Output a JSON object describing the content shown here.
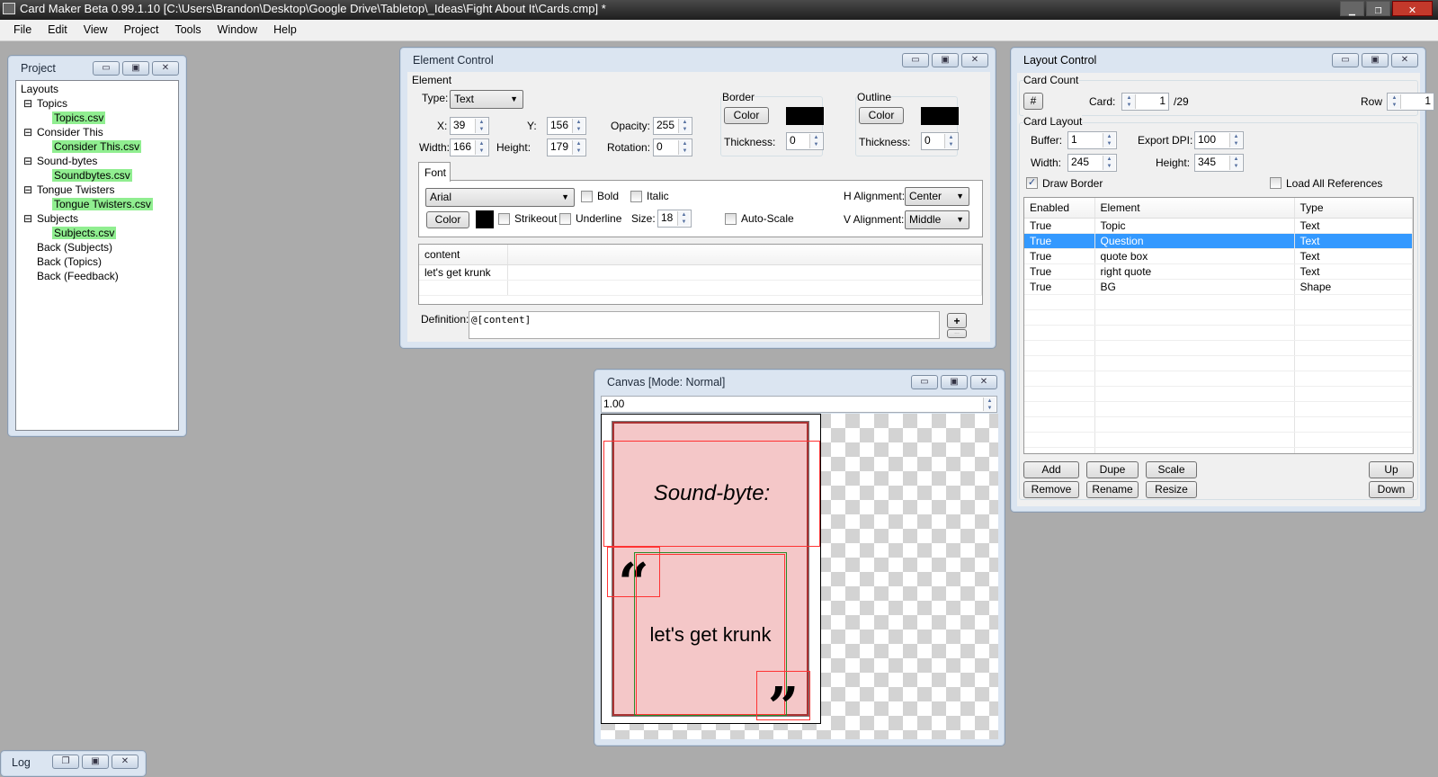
{
  "app": {
    "title": "Card Maker Beta 0.99.1.10 [C:\\Users\\Brandon\\Desktop\\Google Drive\\Tabletop\\_Ideas\\Fight About It\\Cards.cmp] *"
  },
  "menu": [
    "File",
    "Edit",
    "View",
    "Project",
    "Tools",
    "Window",
    "Help"
  ],
  "project": {
    "title": "Project",
    "root": "Layouts",
    "items": [
      {
        "label": "Topics",
        "file": "Topics.csv"
      },
      {
        "label": "Consider This",
        "file": "Consider This.csv"
      },
      {
        "label": "Sound-bytes",
        "file": "Soundbytes.csv"
      },
      {
        "label": "Tongue Twisters",
        "file": "Tongue Twisters.csv"
      },
      {
        "label": "Subjects",
        "file": "Subjects.csv"
      }
    ],
    "leaves": [
      "Back (Subjects)",
      "Back (Topics)",
      "Back (Feedback)"
    ]
  },
  "log": {
    "title": "Log"
  },
  "element": {
    "title": "Element Control",
    "group": "Element",
    "type_label": "Type:",
    "type": "Text",
    "x_label": "X:",
    "x": "39",
    "y_label": "Y:",
    "y": "156",
    "opacity_label": "Opacity:",
    "opacity": "255",
    "width_label": "Width:",
    "width": "166",
    "height_label": "Height:",
    "height": "179",
    "rotation_label": "Rotation:",
    "rotation": "0",
    "border": {
      "label": "Border",
      "color_btn": "Color",
      "thickness_label": "Thickness:",
      "thickness": "0",
      "color": "#000000"
    },
    "outline": {
      "label": "Outline",
      "color_btn": "Color",
      "thickness_label": "Thickness:",
      "thickness": "0",
      "color": "#000000"
    },
    "font_tab": "Font",
    "font": "Arial",
    "bold": "Bold",
    "italic": "Italic",
    "color_btn": "Color",
    "strikeout": "Strikeout",
    "underline": "Underline",
    "size_label": "Size:",
    "size": "18",
    "autoscale": "Auto-Scale",
    "halign_label": "H Alignment:",
    "halign": "Center",
    "valign_label": "V Alignment:",
    "valign": "Middle",
    "grid_header": "content",
    "grid_value": "let's get krunk",
    "definition_label": "Definition:",
    "definition": "@[content]",
    "plus": "+",
    "more": "..."
  },
  "canvas": {
    "title": "Canvas [Mode: Normal]",
    "zoom": "1.00",
    "topic_text": "Sound-byte:",
    "question_text": "let's get krunk",
    "open_quote": "“",
    "close_quote": "”"
  },
  "layout": {
    "title": "Layout Control",
    "card_count": "Card Count",
    "hash": "#",
    "card_label": "Card:",
    "card": "1",
    "total": "/29",
    "row_label": "Row",
    "row": "1",
    "card_layout": "Card Layout",
    "buffer_label": "Buffer:",
    "buffer": "1",
    "dpi_label": "Export DPI:",
    "dpi": "100",
    "width_label": "Width:",
    "width": "245",
    "height_label": "Height:",
    "height": "345",
    "draw_border": "Draw Border",
    "load_refs": "Load All References",
    "columns": [
      "Enabled",
      "Element",
      "Type"
    ],
    "rows": [
      [
        "True",
        "Topic",
        "Text"
      ],
      [
        "True",
        "Question",
        "Text"
      ],
      [
        "True",
        "quote box",
        "Text"
      ],
      [
        "True",
        "right quote",
        "Text"
      ],
      [
        "True",
        "BG",
        "Shape"
      ]
    ],
    "buttons": {
      "add": "Add",
      "dupe": "Dupe",
      "scale": "Scale",
      "up": "Up",
      "remove": "Remove",
      "rename": "Rename",
      "resize": "Resize",
      "down": "Down"
    }
  }
}
